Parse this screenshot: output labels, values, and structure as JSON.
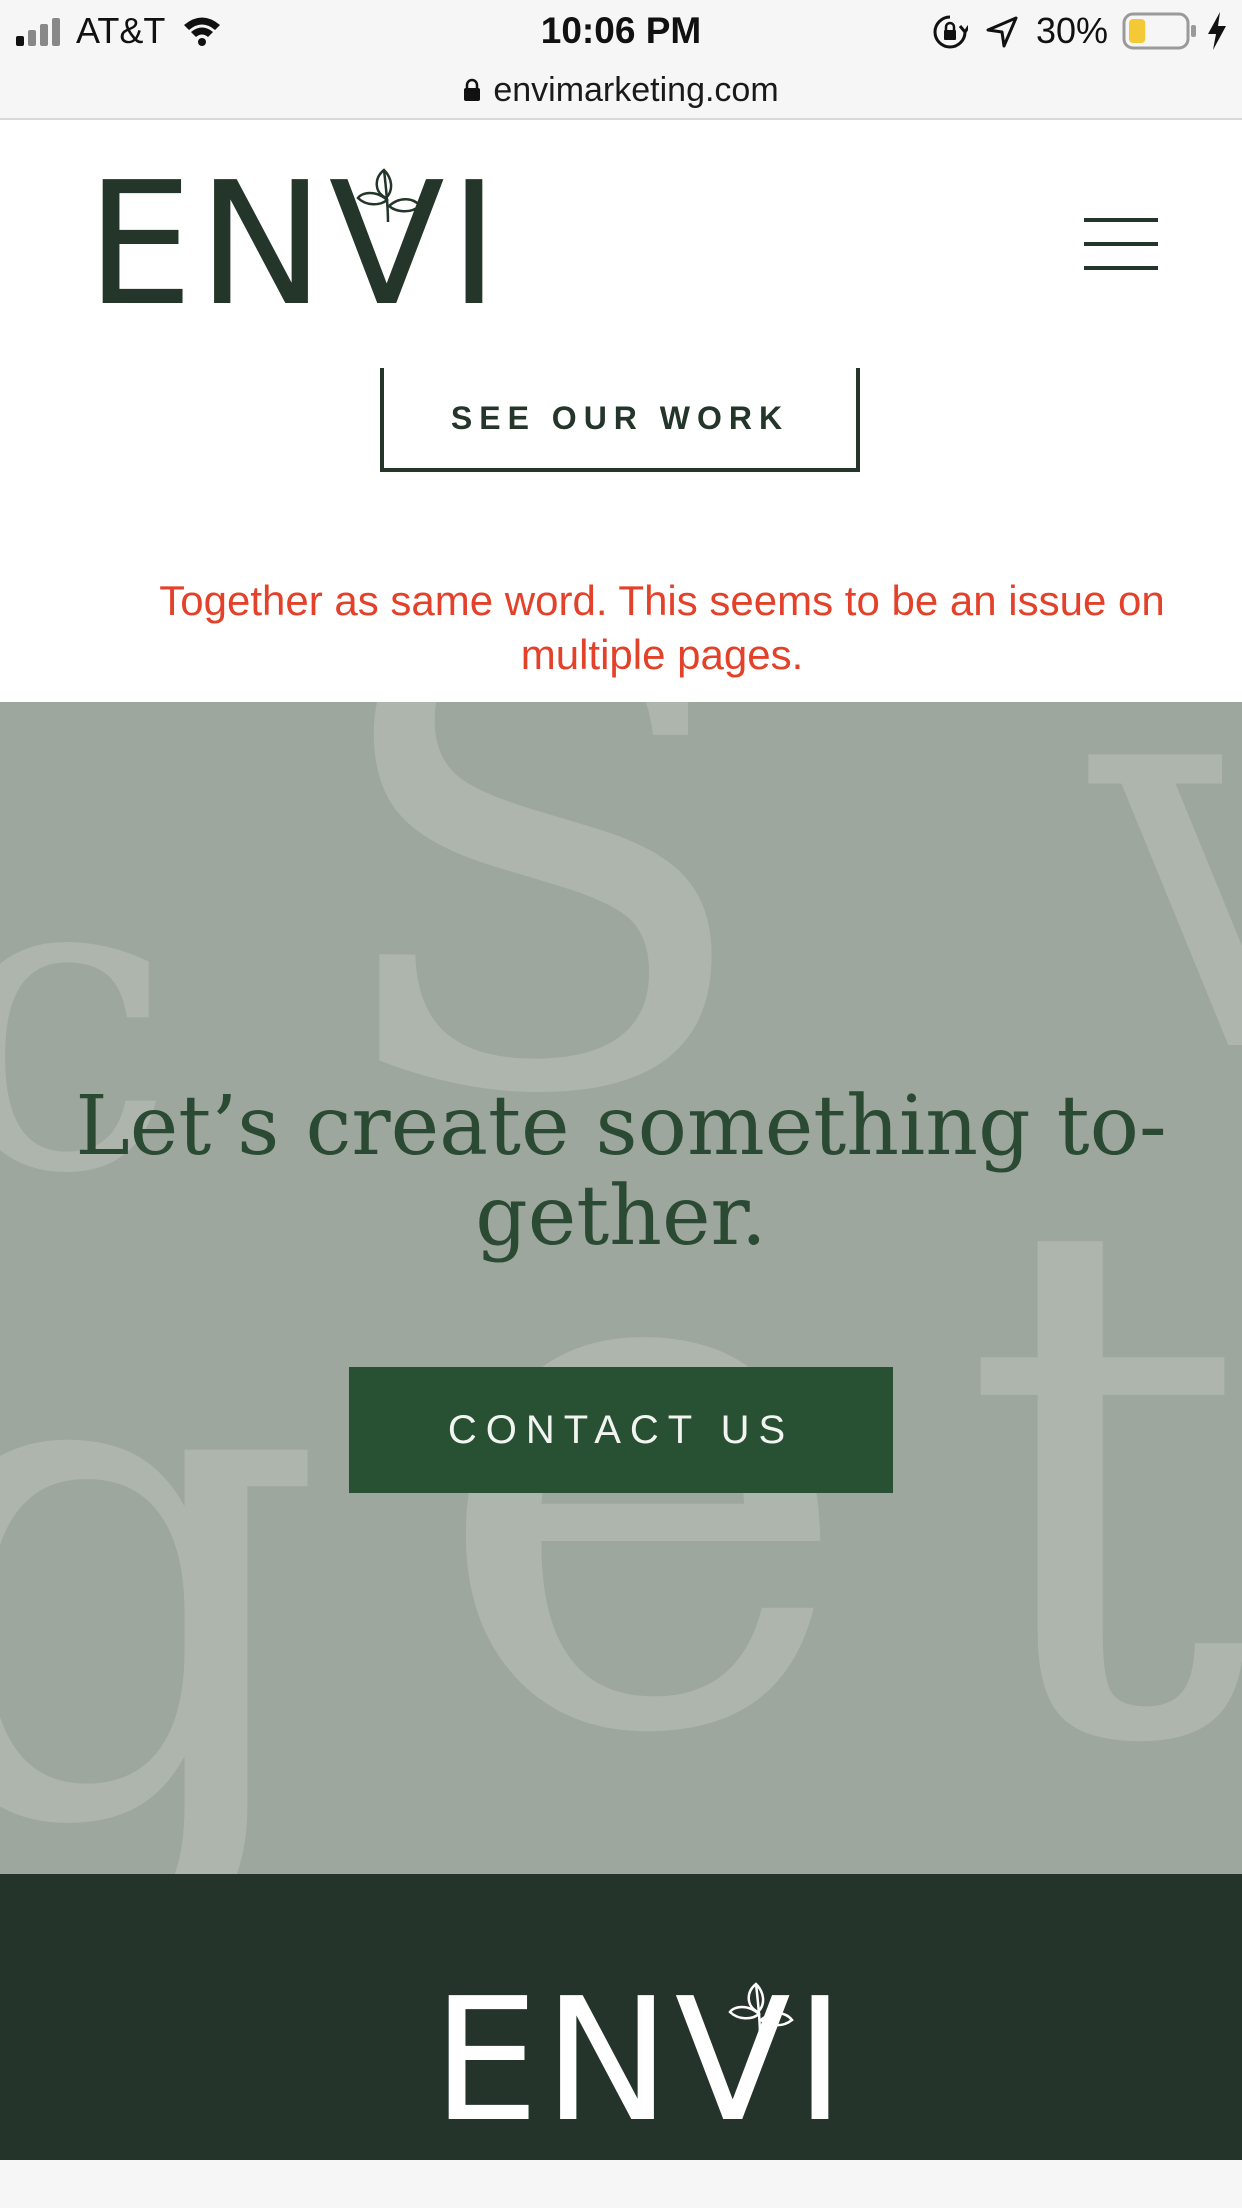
{
  "status_bar": {
    "carrier": "AT&T",
    "time": "10:06 PM",
    "battery_percent": "30%",
    "icons": [
      "signal-icon",
      "wifi-icon",
      "rotation-lock-icon",
      "location-arrow-icon",
      "battery-icon",
      "charging-bolt-icon"
    ],
    "battery_level": 0.3,
    "battery_color": "#f5c836"
  },
  "browser": {
    "url": "envimarketing.com",
    "lock_icon": "lock-icon"
  },
  "header": {
    "logo_text": "ENVI",
    "menu_icon": "hamburger-menu-icon"
  },
  "work_section": {
    "see_work_label": "SEE OUR WORK"
  },
  "annotation": {
    "note": "Together as same word. This seems to be an issue on multiple pages."
  },
  "cta": {
    "background_text": "Let’s create something together",
    "heading_line1": "Let’s create something to-",
    "heading_line2": "gether.",
    "contact_label": "CONTACT US"
  },
  "footer": {
    "logo_text": "ENVI"
  },
  "colors": {
    "brand_dark": "#233629",
    "footer_bg": "#25342b",
    "cta_bg": "#9ea79d",
    "button_green": "#285032",
    "note_red": "#e3412a"
  }
}
